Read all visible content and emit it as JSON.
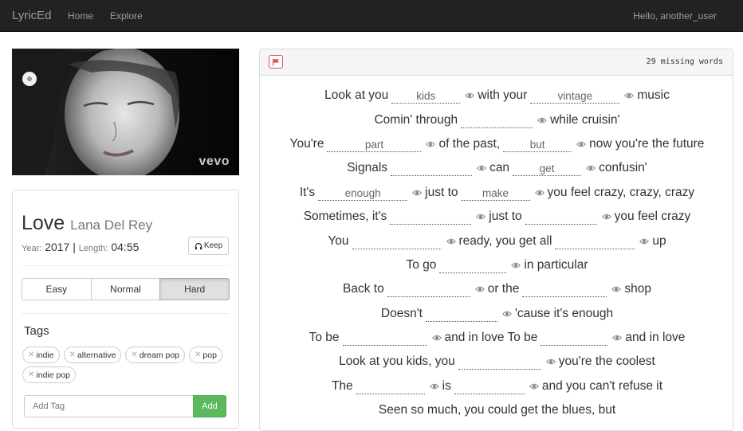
{
  "navbar": {
    "brand": "LyricEd",
    "links": [
      "Home",
      "Explore"
    ],
    "user_greeting": "Hello, another_user"
  },
  "video": {
    "watermark": "vevo"
  },
  "song": {
    "title": "Love",
    "artist": "Lana Del Rey",
    "year_label": "Year:",
    "year": "2017",
    "length_label": "Length:",
    "length": "04:55",
    "keep_label": "Keep",
    "keep_icon": "headphones-icon"
  },
  "difficulty": {
    "options": [
      "Easy",
      "Normal",
      "Hard"
    ],
    "selected": "Hard"
  },
  "tags": {
    "heading": "Tags",
    "items": [
      "indie",
      "alternative",
      "dream pop",
      "pop",
      "indie pop"
    ],
    "input_placeholder": "Add Tag",
    "add_label": "Add"
  },
  "lyrics": {
    "missing_count": "29 missing words",
    "flag_icon": "flag-icon",
    "colors": {
      "flag": "#d9534f",
      "add": "#5cb85c"
    },
    "lines": [
      [
        {
          "t": "Look at you"
        },
        {
          "b": "kids"
        },
        {
          "t": "with your"
        },
        {
          "b": "vintage"
        },
        {
          "t": "music"
        }
      ],
      [
        {
          "t": "Comin' through"
        },
        {
          "b": ""
        },
        {
          "t": "while cruisin'"
        }
      ],
      [
        {
          "t": "You're"
        },
        {
          "b": "part"
        },
        {
          "t": "of the past,"
        },
        {
          "b": "but"
        },
        {
          "t": "now you're the future"
        }
      ],
      [
        {
          "t": "Signals"
        },
        {
          "b": ""
        },
        {
          "t": "can"
        },
        {
          "b": "get"
        },
        {
          "t": "confusin'"
        }
      ],
      [
        {
          "t": "It's"
        },
        {
          "b": "enough"
        },
        {
          "t": "just to"
        },
        {
          "b": "make"
        },
        {
          "t": "you feel crazy, crazy, crazy"
        }
      ],
      [
        {
          "t": "Sometimes, it's"
        },
        {
          "b": ""
        },
        {
          "t": "just to"
        },
        {
          "b": ""
        },
        {
          "t": "you feel crazy"
        }
      ],
      [
        {
          "t": "You"
        },
        {
          "b": ""
        },
        {
          "t": "ready, you get all"
        },
        {
          "b": ""
        },
        {
          "t": "up"
        }
      ],
      [
        {
          "t": "To go"
        },
        {
          "b": ""
        },
        {
          "t": "in particular"
        }
      ],
      [
        {
          "t": "Back to"
        },
        {
          "b": ""
        },
        {
          "t": "or the"
        },
        {
          "b": ""
        },
        {
          "t": "shop"
        }
      ],
      [
        {
          "t": "Doesn't"
        },
        {
          "b": ""
        },
        {
          "t": "'cause it's enough"
        }
      ],
      [
        {
          "t": "To be"
        },
        {
          "b": ""
        },
        {
          "t": "and in love To be"
        },
        {
          "b": ""
        },
        {
          "t": "and in love"
        }
      ],
      [
        {
          "t": "Look at you kids, you"
        },
        {
          "b": ""
        },
        {
          "t": "you're the coolest"
        }
      ],
      [
        {
          "t": "The"
        },
        {
          "b": ""
        },
        {
          "t": "is"
        },
        {
          "b": ""
        },
        {
          "t": "and you can't refuse it"
        }
      ],
      [
        {
          "t": "Seen so much, you could get the blues, but"
        }
      ]
    ]
  }
}
